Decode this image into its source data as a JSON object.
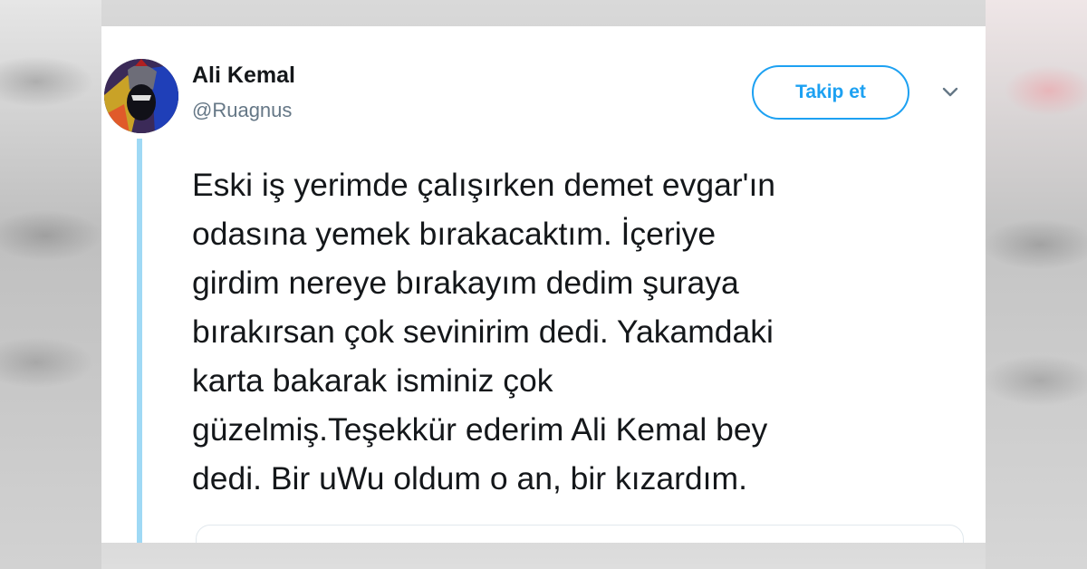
{
  "author": {
    "name": "Ali Kemal",
    "handle": "@Ruagnus",
    "avatar_icon": "profile-avatar"
  },
  "actions": {
    "follow_label": "Takip et",
    "menu_icon": "chevron-down-icon"
  },
  "tweet": {
    "text": "Eski iş yerimde çalışırken demet evgar'ın\nodasına yemek bırakacaktım. İçeriye\ngirdim nereye bırakayım dedim şuraya\nbırakırsan çok sevinirim dedi. Yakamdaki\nkarta bakarak isminiz çok\ngüzelmiş.Teşekkür ederim Ali Kemal bey\ndedi. Bir uWu oldum o an, bir kızardım."
  },
  "colors": {
    "accent": "#1da1f2",
    "thread_line": "#9fd9f5",
    "text": "#14171a",
    "muted": "#657786"
  }
}
